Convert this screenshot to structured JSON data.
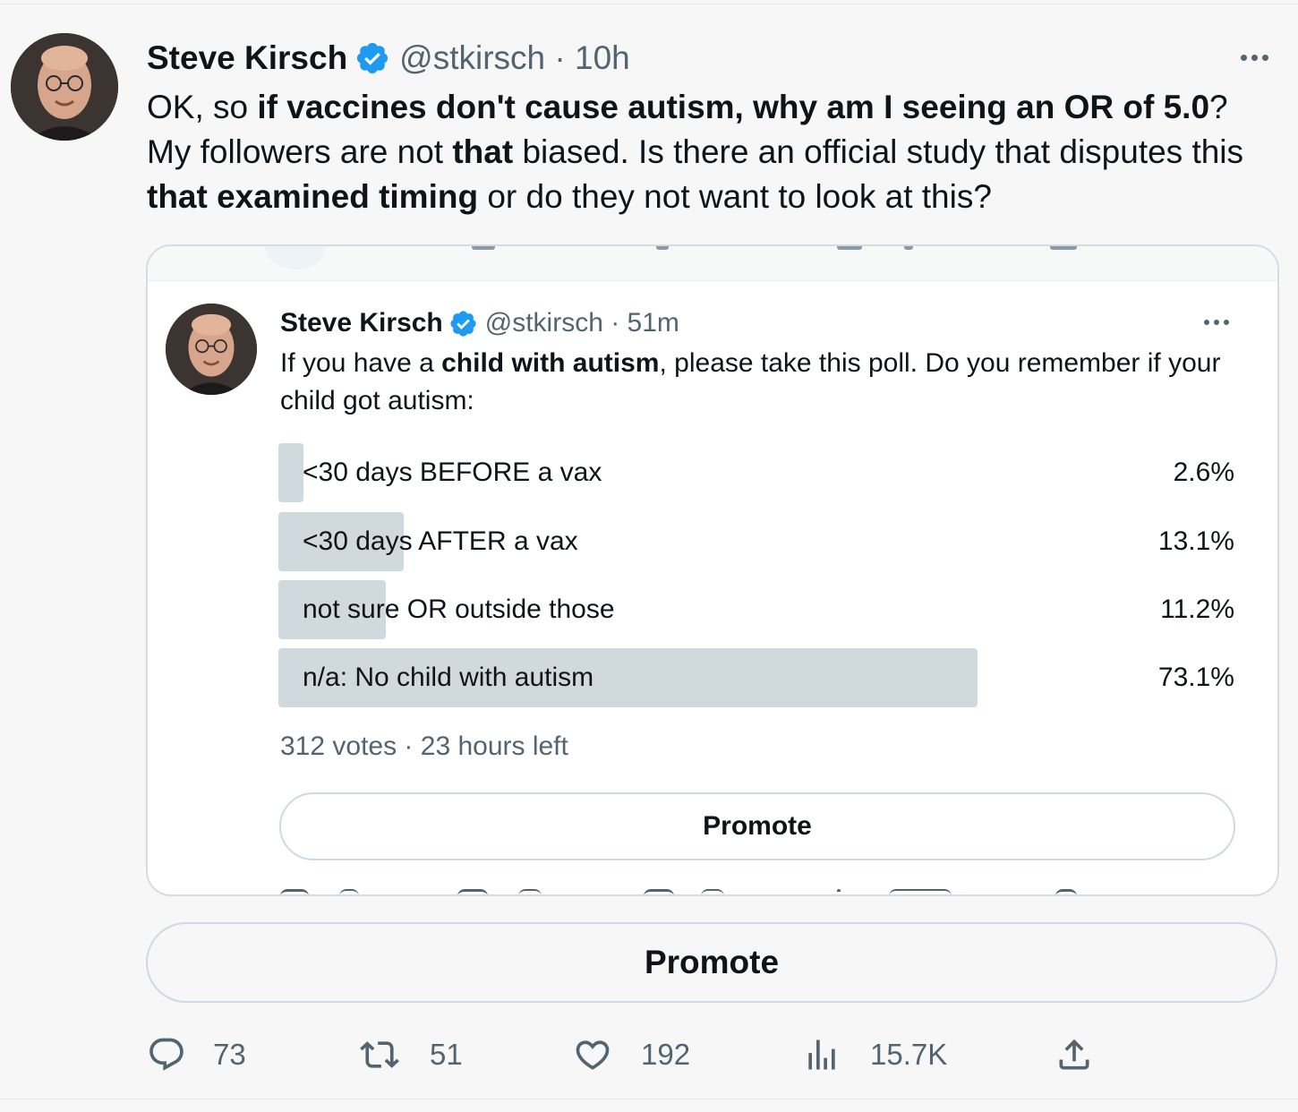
{
  "tweet": {
    "author_name": "Steve Kirsch",
    "handle_time": "@stkirsch · 10h",
    "text_segments": [
      {
        "t": "OK, so ",
        "b": false
      },
      {
        "t": "if vaccines don't cause autism, why am I seeing an OR of 5.0",
        "b": true
      },
      {
        "t": "? My followers are not ",
        "b": false
      },
      {
        "t": "that",
        "b": true
      },
      {
        "t": " biased. Is there an official study that disputes this ",
        "b": false
      },
      {
        "t": "that examined timing",
        "b": true
      },
      {
        "t": " or do they not want to look at this?",
        "b": false
      }
    ]
  },
  "quote": {
    "author_name": "Steve Kirsch",
    "handle_time": "@stkirsch · 51m",
    "text_segments": [
      {
        "t": "If you have a ",
        "b": false
      },
      {
        "t": "child with autism",
        "b": true
      },
      {
        "t": ", please take this poll. Do you remember if your child got autism:",
        "b": false
      }
    ],
    "poll": {
      "options": [
        {
          "label": "<30 days BEFORE a vax",
          "percent": "2.6%",
          "value": 2.6
        },
        {
          "label": "<30 days AFTER a vax",
          "percent": "13.1%",
          "value": 13.1
        },
        {
          "label": "not sure OR outside those",
          "percent": "11.2%",
          "value": 11.2
        },
        {
          "label": "n/a: No child with autism",
          "percent": "73.1%",
          "value": 73.1
        }
      ],
      "meta": "312 votes · 23 hours left"
    },
    "promote_label": "Promote"
  },
  "promote_label": "Promote",
  "actions": {
    "replies": "73",
    "retweets": "51",
    "likes": "192",
    "views": "15.7K"
  },
  "colors": {
    "verified": "#1d9bf0",
    "poll_bar": "#cfd9de",
    "muted_text": "#536471"
  }
}
